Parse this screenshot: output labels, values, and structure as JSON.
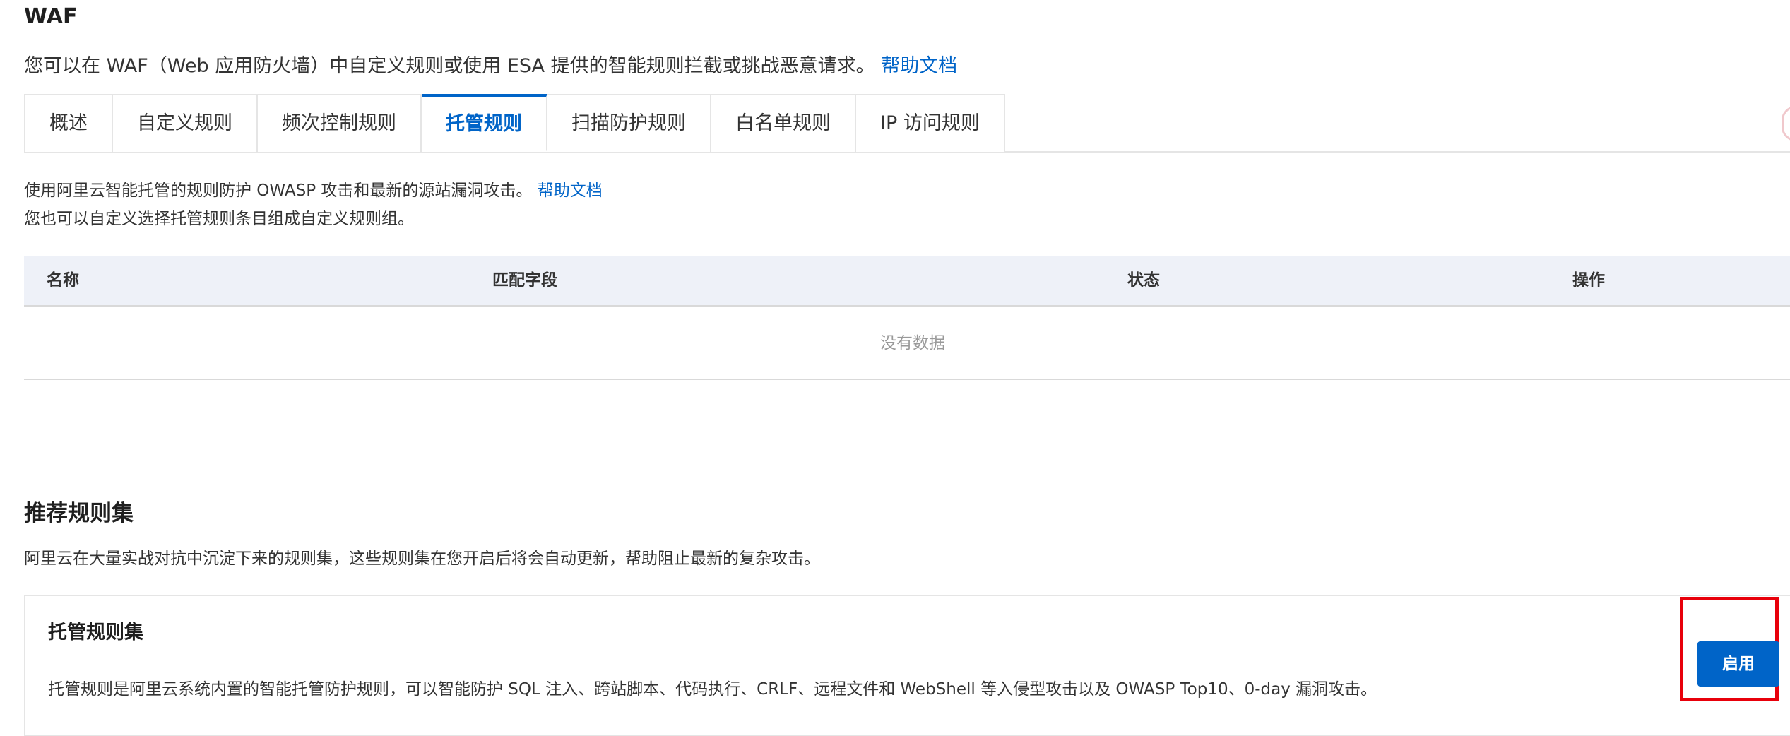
{
  "header": {
    "title": "WAF",
    "intro_text": "您可以在 WAF（Web 应用防火墙）中自定义规则或使用 ESA 提供的智能规则拦截或挑战恶意请求。",
    "intro_link": "帮助文档"
  },
  "tabs": [
    {
      "label": "概述",
      "active": false
    },
    {
      "label": "自定义规则",
      "active": false
    },
    {
      "label": "频次控制规则",
      "active": false
    },
    {
      "label": "托管规则",
      "active": true
    },
    {
      "label": "扫描防护规则",
      "active": false
    },
    {
      "label": "白名单规则",
      "active": false
    },
    {
      "label": "IP 访问规则",
      "active": false
    }
  ],
  "managed": {
    "desc_line1": "使用阿里云智能托管的规则防护 OWASP 攻击和最新的源站漏洞攻击。",
    "desc_link": "帮助文档",
    "desc_line2": "您也可以自定义选择托管规则条目组成自定义规则组。"
  },
  "table": {
    "columns": [
      "名称",
      "匹配字段",
      "状态",
      "操作"
    ],
    "empty_text": "没有数据"
  },
  "recommended": {
    "title": "推荐规则集",
    "desc": "阿里云在大量实战对抗中沉淀下来的规则集，这些规则集在您开启后将会自动更新，帮助阻止最新的复杂攻击。",
    "card": {
      "title": "托管规则集",
      "desc": "托管规则是阿里云系统内置的智能托管防护规则，可以智能防护 SQL 注入、跨站脚本、代码执行、CRLF、远程文件和 WebShell 等入侵型攻击以及 OWASP Top10、0-day 漏洞攻击。",
      "button_label": "启用"
    }
  },
  "colors": {
    "accent": "#0064c8",
    "highlight_box": "#e8000b",
    "table_header_bg": "#eef1f8"
  }
}
